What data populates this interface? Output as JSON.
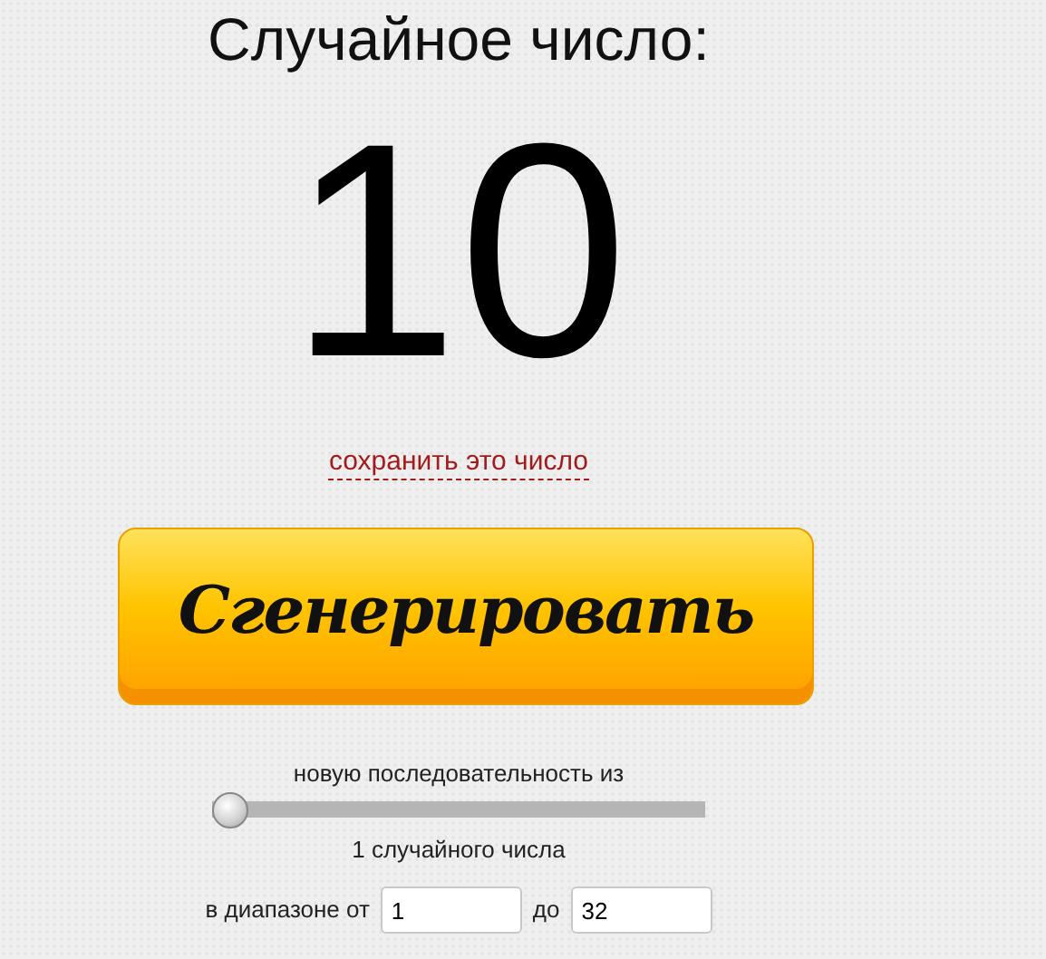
{
  "title": "Случайное число:",
  "number": "10",
  "save_link": "сохранить это число",
  "generate_button": "Сгенерировать",
  "sequence": {
    "label_before": "новую последовательность из",
    "level": 0,
    "label_after": "1 случайного числа"
  },
  "range": {
    "from_label": "в диапазоне от",
    "from_value": "1",
    "to_label": "до",
    "to_value": "32"
  }
}
